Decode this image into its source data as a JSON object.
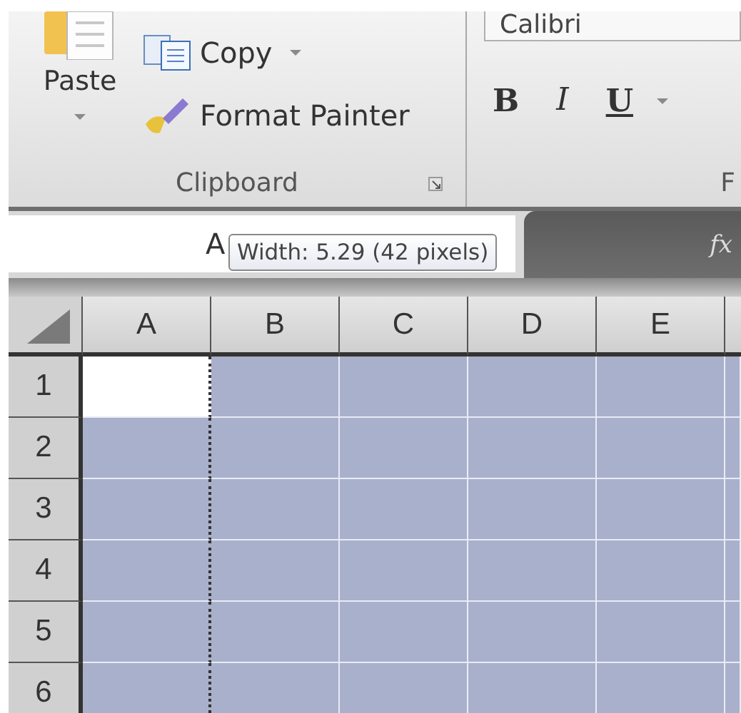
{
  "ribbon": {
    "clipboard": {
      "paste": "Paste",
      "copy": "Copy",
      "format_painter": "Format Painter",
      "label": "Clipboard"
    },
    "font": {
      "font_name": "Calibri",
      "bold": "B",
      "italic": "I",
      "underline": "U",
      "label": "F"
    }
  },
  "formula_bar": {
    "name_box": "A",
    "tooltip": "Width: 5.29 (42 pixels)",
    "fx": "fx"
  },
  "grid": {
    "columns": [
      "A",
      "B",
      "C",
      "D",
      "E"
    ],
    "rows": [
      {
        "label": "1",
        "cells": [
          {
            "selected": false
          },
          {
            "selected": true
          },
          {
            "selected": true
          },
          {
            "selected": true
          },
          {
            "selected": true
          },
          {
            "selected": true
          }
        ]
      },
      {
        "label": "2",
        "cells": [
          {
            "selected": true
          },
          {
            "selected": true
          },
          {
            "selected": true
          },
          {
            "selected": true
          },
          {
            "selected": true
          },
          {
            "selected": true
          }
        ]
      },
      {
        "label": "3",
        "cells": [
          {
            "selected": true
          },
          {
            "selected": true
          },
          {
            "selected": true
          },
          {
            "selected": true
          },
          {
            "selected": true
          },
          {
            "selected": true
          }
        ]
      },
      {
        "label": "4",
        "cells": [
          {
            "selected": true
          },
          {
            "selected": true
          },
          {
            "selected": true
          },
          {
            "selected": true
          },
          {
            "selected": true
          },
          {
            "selected": true
          }
        ]
      },
      {
        "label": "5",
        "cells": [
          {
            "selected": true
          },
          {
            "selected": true
          },
          {
            "selected": true
          },
          {
            "selected": true
          },
          {
            "selected": true
          },
          {
            "selected": true
          }
        ]
      },
      {
        "label": "6",
        "cells": [
          {
            "selected": true
          },
          {
            "selected": true
          },
          {
            "selected": true
          },
          {
            "selected": true
          },
          {
            "selected": true
          },
          {
            "selected": true
          }
        ]
      }
    ]
  }
}
